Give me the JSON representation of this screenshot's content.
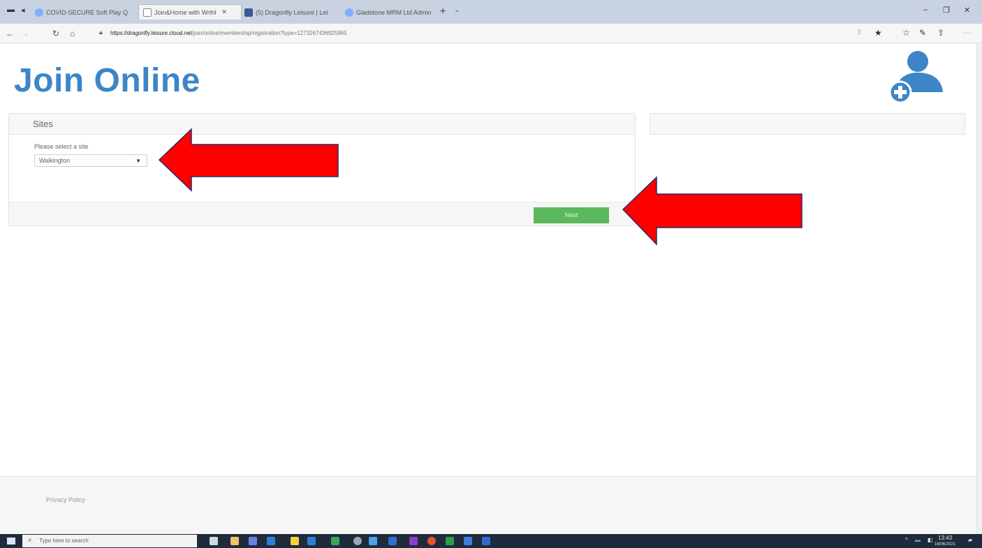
{
  "browser": {
    "tabs": [
      {
        "label": "COVID-SECURE Soft Play Q"
      },
      {
        "label": "Join&Home with Wrthl"
      },
      {
        "label": "(5) Dragonfly Leisure | Lei"
      },
      {
        "label": "Gladstone MRM Ltd Admin"
      }
    ],
    "new_tab_symbol": "+",
    "tab_menu_symbol": "⌄",
    "url_host": "https://dragonfly.leisure.cloud.net",
    "url_path": "/join/online/membership/registration?type=1273267436925965",
    "window_controls": [
      "–",
      "❐",
      "✕"
    ]
  },
  "page": {
    "title": "Join Online",
    "user_icon": "user-add-icon",
    "panel": {
      "heading": "Sites",
      "select_label": "Please select a site",
      "select_value": "Walkington",
      "next_label": "Next"
    },
    "footer": {
      "privacy_link": "Privacy Policy"
    }
  },
  "taskbar": {
    "search_placeholder": "Type here to search",
    "clock_time": "13:43",
    "clock_date": "16/06/2021"
  },
  "colors": {
    "title_blue": "#3d85c6",
    "next_green": "#5cb85c",
    "arrow_red": "#ff0000",
    "taskbar": "#1f2b3a"
  }
}
